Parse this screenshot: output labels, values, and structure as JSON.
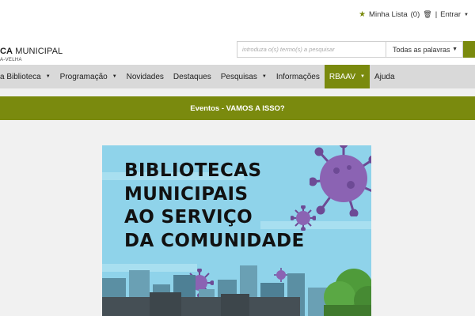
{
  "header": {
    "my_list_label": "Minha Lista",
    "my_list_count": "(0)",
    "separator": "|",
    "login_label": "Entrar"
  },
  "logo": {
    "line1_bold": "CA",
    "line1_rest": " MUNICIPAL",
    "line2": "A-VELHA"
  },
  "search": {
    "placeholder": "introduza o(s) termo(s) a pesquisar",
    "mode_selected": "Todas as palavras"
  },
  "nav": {
    "items": [
      {
        "label": "a Biblioteca",
        "dropdown": true
      },
      {
        "label": "Programação",
        "dropdown": true
      },
      {
        "label": "Novidades",
        "dropdown": false
      },
      {
        "label": "Destaques",
        "dropdown": false
      },
      {
        "label": "Pesquisas",
        "dropdown": true
      },
      {
        "label": "Informações",
        "dropdown": false
      },
      {
        "label": "RBAAV",
        "dropdown": true,
        "active": true
      },
      {
        "label": "Ajuda",
        "dropdown": false
      }
    ]
  },
  "banner": {
    "title": "Eventos - VAMOS A ISSO?"
  },
  "poster": {
    "lines": [
      "BIBLIOTECAS",
      "MUNICIPAIS",
      "AO SERVIÇO",
      "DA COMUNIDADE"
    ]
  },
  "colors": {
    "accent": "#7a8a0e",
    "nav_bg": "#d9d9d9",
    "poster_sky": "#8fd3ea",
    "virus": "#8b63b3"
  },
  "icons": {
    "my_list": "star-icon",
    "login_prefix": "trash-icon"
  }
}
